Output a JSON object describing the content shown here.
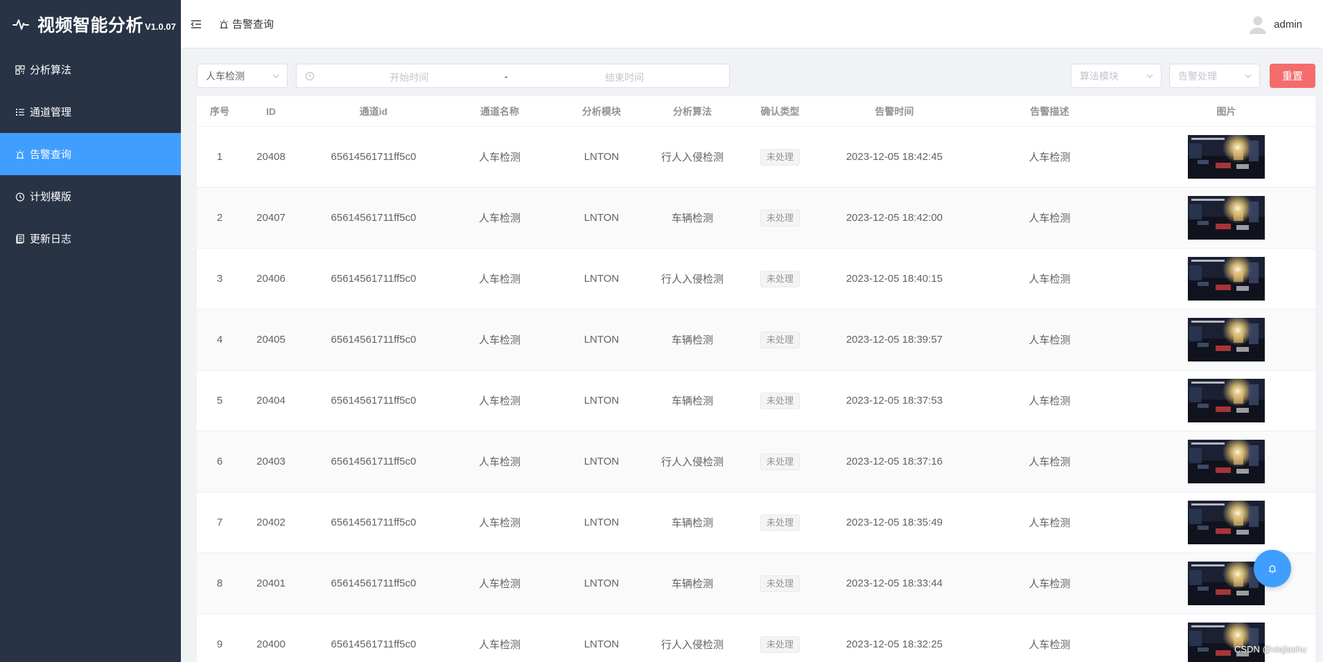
{
  "app": {
    "title": "视频智能分析",
    "version": "V1.0.07"
  },
  "sidebar": {
    "items": [
      {
        "label": "分析算法",
        "icon": "grid-icon"
      },
      {
        "label": "通道管理",
        "icon": "list-icon"
      },
      {
        "label": "告警查询",
        "icon": "alarm-icon",
        "active": true
      },
      {
        "label": "计划模版",
        "icon": "clock-icon"
      },
      {
        "label": "更新日志",
        "icon": "document-icon"
      }
    ]
  },
  "header": {
    "breadcrumb": "告警查询",
    "user": "admin"
  },
  "filters": {
    "channel_select": "人车检测",
    "start_placeholder": "开始时间",
    "separator": "-",
    "end_placeholder": "结束时间",
    "algo_module_placeholder": "算法模块",
    "alarm_handle_placeholder": "告警处理",
    "reset_label": "重置"
  },
  "table": {
    "columns": [
      "序号",
      "ID",
      "通道id",
      "通道名称",
      "分析模块",
      "分析算法",
      "确认类型",
      "告警时间",
      "告警描述",
      "图片"
    ],
    "rows": [
      [
        "1",
        "20408",
        "65614561711ff5c0",
        "人车检测",
        "LNTON",
        "行人入侵检测",
        "未处理",
        "2023-12-05 18:42:45",
        "人车检测"
      ],
      [
        "2",
        "20407",
        "65614561711ff5c0",
        "人车检测",
        "LNTON",
        "车辆检测",
        "未处理",
        "2023-12-05 18:42:00",
        "人车检测"
      ],
      [
        "3",
        "20406",
        "65614561711ff5c0",
        "人车检测",
        "LNTON",
        "行人入侵检测",
        "未处理",
        "2023-12-05 18:40:15",
        "人车检测"
      ],
      [
        "4",
        "20405",
        "65614561711ff5c0",
        "人车检测",
        "LNTON",
        "车辆检测",
        "未处理",
        "2023-12-05 18:39:57",
        "人车检测"
      ],
      [
        "5",
        "20404",
        "65614561711ff5c0",
        "人车检测",
        "LNTON",
        "车辆检测",
        "未处理",
        "2023-12-05 18:37:53",
        "人车检测"
      ],
      [
        "6",
        "20403",
        "65614561711ff5c0",
        "人车检测",
        "LNTON",
        "行人入侵检测",
        "未处理",
        "2023-12-05 18:37:16",
        "人车检测"
      ],
      [
        "7",
        "20402",
        "65614561711ff5c0",
        "人车检测",
        "LNTON",
        "车辆检测",
        "未处理",
        "2023-12-05 18:35:49",
        "人车检测"
      ],
      [
        "8",
        "20401",
        "65614561711ff5c0",
        "人车检测",
        "LNTON",
        "车辆检测",
        "未处理",
        "2023-12-05 18:33:44",
        "人车检测"
      ],
      [
        "9",
        "20400",
        "65614561711ff5c0",
        "人车检测",
        "LNTON",
        "行人入侵检测",
        "未处理",
        "2023-12-05 18:32:25",
        "人车检测"
      ]
    ]
  },
  "watermark": "CSDN @xiejiashu",
  "colors": {
    "sidebar": "#283345",
    "accent": "#409eff",
    "danger": "#f56c6c"
  }
}
